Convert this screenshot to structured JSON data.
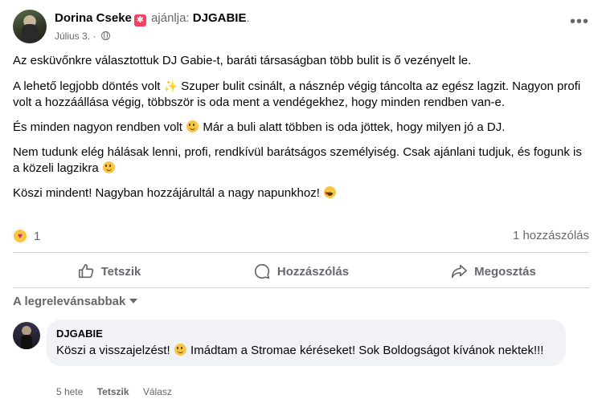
{
  "post": {
    "author": "Dorina Cseke",
    "verb": "ajánlja:",
    "target": "DJGABIE",
    "date": "Július 3.",
    "paragraphs": [
      [
        "Az esküvőnkre választottuk DJ Gabie-t, baráti társaságban több bulit is ő vezényelt le."
      ],
      [
        "A lehető legjobb döntés volt ",
        "Szuper bulit csinált, a násznép végig táncolta az egész lagzit. Nagyon profi volt a hozzáállása végig, többször is oda ment a vendégekhez, hogy minden rendben van-e."
      ],
      [
        "És minden nagyon rendben volt ",
        " Már a buli alatt többen is oda jöttek, hogy milyen jó a DJ."
      ],
      [
        "Nem tudunk elég hálásak lenni, profi, rendkívül barátságos személyiség. Csak ajánlani tudjuk, és fogunk is a közeli lagzikra "
      ],
      [
        "Köszi mindent! Nagyban hozzájárultál a nagy napunkhoz! "
      ]
    ],
    "reaction_count": "1",
    "comment_count": "1 hozzászólás"
  },
  "actions": {
    "like": "Tetszik",
    "comment": "Hozzászólás",
    "share": "Megosztás"
  },
  "sort_label": "A legrelevánsabbak",
  "comment": {
    "author": "DJGABIE",
    "text_part1": "Köszi a visszajelzést! ",
    "text_part2": " Imádtam a Stromae kéréseket! Sok Boldogságot kívánok nektek!!!",
    "time": "5 hete",
    "like": "Tetszik",
    "reply": "Válasz"
  },
  "colors": {
    "secondary_text": "#65676b",
    "divider": "#ced0d4",
    "bubble": "#f0f2f5",
    "recommend_badge": "#f3425f"
  },
  "icons": [
    "recommend-badge-icon",
    "globe-icon",
    "more-options-icon",
    "like-icon",
    "comment-icon",
    "share-icon",
    "caret-down-icon",
    "love-reaction-icon",
    "smile-emoji",
    "sparkles-emoji",
    "heart-eyes-emoji"
  ]
}
